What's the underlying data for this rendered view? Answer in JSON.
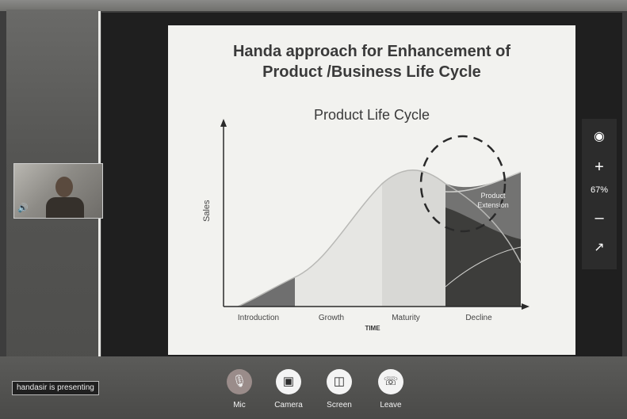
{
  "slide": {
    "title_line1": "Handa approach for Enhancement  of",
    "title_line2": "Product /Business Life Cycle",
    "chart_title": "Product Life Cycle",
    "y_axis_label": "Sales",
    "x_axis_label": "TIME",
    "stages": [
      "Introduction",
      "Growth",
      "Maturity",
      "Decline"
    ],
    "extension_label_line1": "Product",
    "extension_label_line2": "Extension"
  },
  "zoom": {
    "camera_icon": "camera-icon",
    "zoom_in_icon": "plus-icon",
    "level": "67%",
    "zoom_out_icon": "minus-icon",
    "popout_icon": "external-link-icon"
  },
  "presenter": {
    "status": "handasir is presenting"
  },
  "controls": {
    "mic": "Mic",
    "camera": "Camera",
    "screen": "Screen",
    "leave": "Leave"
  }
}
